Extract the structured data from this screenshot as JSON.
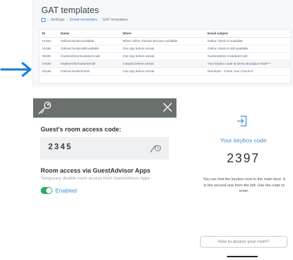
{
  "gat": {
    "title": "GAT templates",
    "breadcrumb": [
      "Settings",
      "Email templates",
      "GAT templates"
    ],
    "columns": [
      "ID",
      "Name",
      "When",
      "Email subject"
    ],
    "rows": [
      [
        "21454",
        "OnlineCheckinAvailable",
        "When online checkin become available",
        "Online check-in available"
      ],
      [
        "31455",
        "OnlineCheckinStillAvailable",
        "One day before arrival",
        "Online check-in still available"
      ],
      [
        "36400",
        "GuestAdvisorInvitationCode",
        "One day before arrival",
        "GuestAdvisor InvitationCode"
      ],
      [
        "47545",
        "KeyBoxInformationEmail",
        "3 day(s) before arrival",
        "Your keybox code at Demo Boutique Hotel***"
      ],
      [
        "45168",
        "OnlineCheckinFinish",
        "One day before arrival",
        "Reminder - Finish Your Check-in"
      ]
    ]
  },
  "colors": {
    "accent": "#1f7fd8",
    "enabled": "#27ad5f",
    "dark_bar": "#6a716d"
  },
  "access_card": {
    "code_heading": "Guest's room access code:",
    "code_value": "2345",
    "apps_heading": "Room access via GuestAdvisor Apps",
    "apps_subtitle": "Temporary disable room access from GuestAdvisor Apps",
    "toggle_label": "Enabled",
    "toggle_on": true
  },
  "keybox": {
    "title": "Your keybox code",
    "code": "2397",
    "description": "You can find the keybox next to the main door. It is the second one from the left. Use the code to enter.",
    "button_label": "How to access your room?"
  },
  "icons": {
    "home": "home-icon",
    "key": "key-icon",
    "close": "close-icon",
    "edit": "edit-pencil-icon",
    "enter": "enter-door-icon",
    "arrow": "right-arrow-icon"
  }
}
